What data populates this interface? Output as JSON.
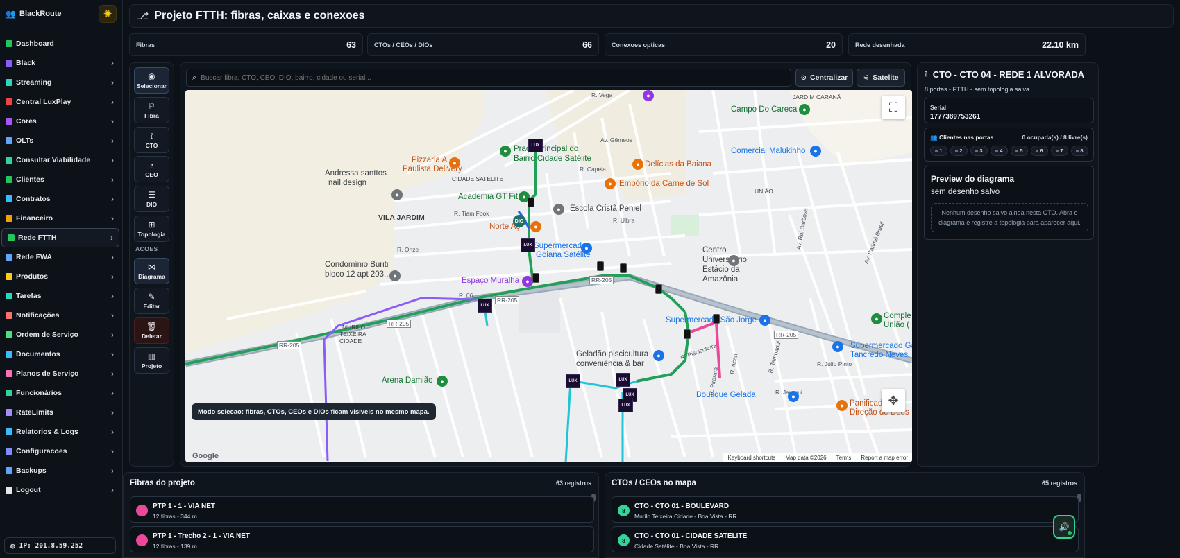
{
  "brand": {
    "name": "BlackRoute",
    "icon": "users-icon",
    "theme_icon": "sun-icon"
  },
  "nav": [
    {
      "label": "Dashboard",
      "color": "#22c55e",
      "chevron": false
    },
    {
      "label": "Black",
      "color": "#8b5cf6",
      "chevron": true
    },
    {
      "label": "Streaming",
      "color": "#2dd4bf",
      "chevron": true
    },
    {
      "label": "Central LuxPlay",
      "color": "#ef4444",
      "chevron": true
    },
    {
      "label": "Cores",
      "color": "#a855f7",
      "chevron": true
    },
    {
      "label": "OLTs",
      "color": "#60a5fa",
      "chevron": true
    },
    {
      "label": "Consultar Viabilidade",
      "color": "#34d399",
      "chevron": true
    },
    {
      "label": "Clientes",
      "color": "#22c55e",
      "chevron": true
    },
    {
      "label": "Contratos",
      "color": "#38bdf8",
      "chevron": true
    },
    {
      "label": "Financeiro",
      "color": "#f59e0b",
      "chevron": true
    },
    {
      "label": "Rede FTTH",
      "color": "#22c55e",
      "chevron": true,
      "active": true
    },
    {
      "label": "Rede FWA",
      "color": "#60a5fa",
      "chevron": true
    },
    {
      "label": "Produtos",
      "color": "#facc15",
      "chevron": true
    },
    {
      "label": "Tarefas",
      "color": "#2dd4bf",
      "chevron": true
    },
    {
      "label": "Notificações",
      "color": "#f87171",
      "chevron": true
    },
    {
      "label": "Ordem de Serviço",
      "color": "#4ade80",
      "chevron": true
    },
    {
      "label": "Documentos",
      "color": "#38bdf8",
      "chevron": true
    },
    {
      "label": "Planos de Serviço",
      "color": "#f472b6",
      "chevron": true
    },
    {
      "label": "Funcionários",
      "color": "#34d399",
      "chevron": true
    },
    {
      "label": "RateLimits",
      "color": "#a78bfa",
      "chevron": true
    },
    {
      "label": "Relatorios & Logs",
      "color": "#38bdf8",
      "chevron": true
    },
    {
      "label": "Configuracoes",
      "color": "#818cf8",
      "chevron": true
    },
    {
      "label": "Backups",
      "color": "#60a5fa",
      "chevron": true
    },
    {
      "label": "Logout",
      "color": "#e5e7eb",
      "chevron": true
    }
  ],
  "ip": "IP: 201.8.59.252",
  "header": {
    "title": "Projeto FTTH: fibras, caixas e conexoes",
    "icon": "network-icon"
  },
  "stats": [
    {
      "label": "Fibras",
      "value": "63"
    },
    {
      "label": "CTOs / CEOs / DIOs",
      "value": "66"
    },
    {
      "label": "Conexoes opticas",
      "value": "20"
    },
    {
      "label": "Rede desenhada",
      "value": "22.10 km"
    }
  ],
  "tools": {
    "selecionar": "Selecionar",
    "fibra": "Fibra",
    "cto": "CTO",
    "ceo": "CEO",
    "dio": "DIO",
    "topologia": "Topologia",
    "acoes": "ACOES",
    "diagrama": "Diagrama",
    "editar": "Editar",
    "deletar": "Deletar",
    "projeto": "Projeto"
  },
  "search": {
    "placeholder": "Buscar fibra, CTO, CEO, DIO, bairro, cidade ou serial..."
  },
  "buttons": {
    "centralizar": "Centralizar",
    "satelite": "Satelite"
  },
  "map": {
    "mode_tip": "Modo selecao: fibras, CTOs, CEOs e DIOs ficam visiveis no mesmo mapa.",
    "google": "Google",
    "attribution": [
      "Keyboard shortcuts",
      "Map data ©2026",
      "Terms",
      "Report a map error"
    ],
    "places": [
      {
        "text": "Campo Do Careca",
        "color": "#137333"
      },
      {
        "text": "Comercial Malukinho",
        "color": "#1a73e8"
      },
      {
        "text": "Praça Principal do",
        "color": "#137333"
      },
      {
        "text": "Bairro Cidade Satélite",
        "color": "#137333"
      },
      {
        "text": "Pizzaria A",
        "color": "#c5541b"
      },
      {
        "text": "Paulista Delivery",
        "color": "#c5541b"
      },
      {
        "text": "Delícias da Baiana",
        "color": "#c5541b"
      },
      {
        "text": "Empório da Carne de Sol",
        "color": "#c5541b"
      },
      {
        "text": "Andressa santtos",
        "color": "#3c4043"
      },
      {
        "text": "nail design",
        "color": "#3c4043"
      },
      {
        "text": "Academia GT Fit",
        "color": "#137333"
      },
      {
        "text": "Escola Cristã Peniel",
        "color": "#3c4043"
      },
      {
        "text": "VILA JARDIM",
        "color": "#3c4043"
      },
      {
        "text": "Norte Aç",
        "color": "#c5541b"
      },
      {
        "text": "Supermercado",
        "color": "#1a73e8"
      },
      {
        "text": "Goiana Satélite",
        "color": "#1a73e8"
      },
      {
        "text": "Condomínio Buriti",
        "color": "#3c4043"
      },
      {
        "text": "bloco 12 apt 203...",
        "color": "#3c4043"
      },
      {
        "text": "Espaço Muralha",
        "color": "#9334e6"
      },
      {
        "text": "Centro",
        "color": "#3c4043"
      },
      {
        "text": "Universitário",
        "color": "#3c4043"
      },
      {
        "text": "Estácio da",
        "color": "#3c4043"
      },
      {
        "text": "Amazônia",
        "color": "#3c4043"
      },
      {
        "text": "Supermercado São Jorge",
        "color": "#1a73e8"
      },
      {
        "text": "Comple",
        "color": "#137333"
      },
      {
        "text": "União (",
        "color": "#137333"
      },
      {
        "text": "Supermercado Ga",
        "color": "#1a73e8"
      },
      {
        "text": "Tancredo Neves",
        "color": "#1a73e8"
      },
      {
        "text": "Geladão piscicultura",
        "color": "#3c4043"
      },
      {
        "text": "conveniência & bar",
        "color": "#3c4043"
      },
      {
        "text": "Arena Damião",
        "color": "#137333"
      },
      {
        "text": "Boutique Gelada",
        "color": "#1a73e8"
      },
      {
        "text": "Panificador",
        "color": "#c5541b"
      },
      {
        "text": "Direção de Deus",
        "color": "#c5541b"
      },
      {
        "text": "JARDIM CARANÃ",
        "color": "#3c4043"
      },
      {
        "text": "CIDADE SATÉLITE",
        "color": "#3c4043"
      },
      {
        "text": "UNIÃO",
        "color": "#3c4043"
      },
      {
        "text": "MURILO",
        "color": "#3c4043"
      },
      {
        "text": "TEIXEIRA",
        "color": "#3c4043"
      },
      {
        "text": "CIDADE",
        "color": "#3c4043"
      }
    ],
    "streets": [
      "R. Tiam Fook",
      "R. Ulbra",
      "R. Onze",
      "R. Capela",
      "Av. Gêmeos",
      "R. Vega",
      "R. 06",
      "RR-205",
      "R. Júlio Pinto",
      "R. Jaraqui",
      "Av. Rui Barbosa",
      "Av. Parimé Brasil",
      "R. Piscicultura",
      "R. Tambaqui",
      "R. Pirarara",
      "R. Acari"
    ],
    "dio_label": "DIO"
  },
  "detail": {
    "title": "CTO - CTO 04 - REDE 1 ALVORADA",
    "title_icon": "antenna-icon",
    "subtitle": "8 portas - FTTH - sem topologia salva",
    "serial_label": "Serial",
    "serial_value": "1777389753261",
    "ports_label": "Clientes nas portas",
    "ports_count": "0 ocupada(s) / 8 livre(s)",
    "ports": [
      "1",
      "2",
      "3",
      "4",
      "5",
      "6",
      "7",
      "8"
    ],
    "preview_title": "Preview do diagrama",
    "preview_sub": "sem desenho salvo",
    "preview_empty": "Nenhum desenho salvo ainda nesta CTO. Abra o diagrama e registre a topologia para aparecer aqui."
  },
  "fibers_panel": {
    "title": "Fibras do projeto",
    "count": "63 registros",
    "rows": [
      {
        "title": "PTP 1 - 1 - VIA NET",
        "sub": "12 fibras - 344 m",
        "color": "#ec4899"
      },
      {
        "title": "PTP 1 - Trecho 2 - 1 - VIA NET",
        "sub": "12 fibras - 139 m",
        "color": "#ec4899"
      }
    ]
  },
  "ctos_panel": {
    "title": "CTOs / CEOs no mapa",
    "count": "65 registros",
    "rows": [
      {
        "badge": "8",
        "title": "CTO - CTO 01 - BOULEVARD",
        "sub": "Murilo Teixeira Cidade - Boa Vista - RR"
      },
      {
        "badge": "8",
        "title": "CTO - CTO 01 - CIDADE SATELITE",
        "sub": "Cidade Satélite - Boa Vista - RR"
      }
    ]
  },
  "audio_icon": "speaker-icon"
}
